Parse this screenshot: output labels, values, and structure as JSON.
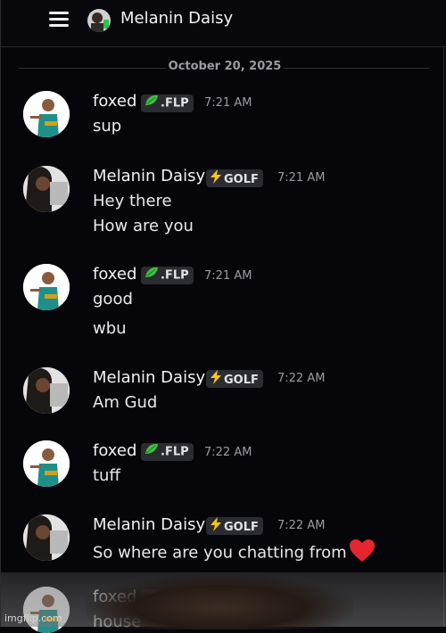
{
  "header": {
    "title": "Melanin Daisy",
    "menu_icon": "hamburger-menu-icon",
    "avatar_icon": "user-avatar-icon"
  },
  "date_divider": "October 20, 2025",
  "tags": {
    "flp": ".FLP",
    "golf": "GOLF"
  },
  "messages": [
    {
      "author": "foxed",
      "tag": ".FLP",
      "time": "7:21 AM",
      "lines": [
        "sup"
      ]
    },
    {
      "author": "Melanin Daisy",
      "tag": "GOLF",
      "time": "7:21 AM",
      "lines": [
        "Hey there",
        "How are you"
      ]
    },
    {
      "author": "foxed",
      "tag": ".FLP",
      "time": "7:21 AM",
      "lines": [
        "good",
        "wbu"
      ]
    },
    {
      "author": "Melanin Daisy",
      "tag": "GOLF",
      "time": "7:22 AM",
      "lines": [
        "Am Gud"
      ]
    },
    {
      "author": "foxed",
      "tag": ".FLP",
      "time": "7:22 AM",
      "lines": [
        "tuff"
      ]
    },
    {
      "author": "Melanin Daisy",
      "tag": "GOLF",
      "time": "7:22 AM",
      "lines": [
        "So where are you chatting from"
      ]
    },
    {
      "author": "foxed",
      "tag": ".FLP",
      "time": "7:22 AM",
      "lines": [
        "house"
      ]
    }
  ],
  "watermark": "imgflip.com",
  "colors": {
    "background": "#06060a",
    "tag_bg": "#2b2c31",
    "leaf_green": "#3fbf3f",
    "bolt_yellow": "#f5c518",
    "heart_red": "#e3262f"
  }
}
